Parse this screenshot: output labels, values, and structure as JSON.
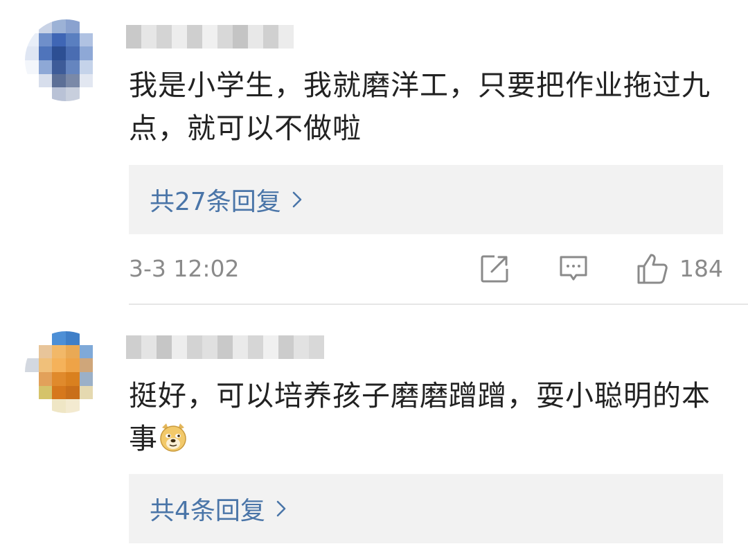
{
  "comments": [
    {
      "text": "我是小学生，我就磨洋工，只要把作业拖过九点，就可以不做啦",
      "replies_label": "共27条回复",
      "time": "3-3 12:02",
      "like_count": "184",
      "avatar_colors": [
        "#ffffff",
        "#c9d3e6",
        "#9cb2d6",
        "#8aa2cf",
        "#ffffff",
        "#ffffff",
        "#e8eef8",
        "#6f8fca",
        "#3f66b5",
        "#5a7fc0",
        "#b0c2e2",
        "#ffffff",
        "#dfe6f3",
        "#4f74bb",
        "#2d4f93",
        "#4a6db2",
        "#8ea8d6",
        "#ffffff",
        "#f3f6fb",
        "#8ea8d6",
        "#3d5b98",
        "#6585bf",
        "#c5d3ea",
        "#ffffff",
        "#ffffff",
        "#d7deec",
        "#5c6f96",
        "#7a89a8",
        "#e2e7f1",
        "#ffffff",
        "#ffffff",
        "#ffffff",
        "#b9c2d6",
        "#c8cfdd",
        "#ffffff",
        "#ffffff"
      ],
      "username_colors": [
        "#c9c9c9",
        "#e6e6e6",
        "#d4d4d4",
        "#ededed",
        "#cfcfcf",
        "#f0f0f0",
        "#d8d8d8",
        "#c4c4c4",
        "#e8e8e8",
        "#d0d0d0",
        "#ececec"
      ]
    },
    {
      "text_before": "挺好，可以培养孩子磨磨蹭蹭，耍小聪明的本事",
      "emoji": "doge-emoji",
      "replies_label": "共4条回复",
      "avatar_colors": [
        "#ffffff",
        "#ffffff",
        "#4d8fd6",
        "#3f7fc8",
        "#ffffff",
        "#ffffff",
        "#ffffff",
        "#e8c59a",
        "#f2b868",
        "#e9a955",
        "#7fa9d8",
        "#ffffff",
        "#d3d8e0",
        "#f0c07a",
        "#f5b25a",
        "#eea347",
        "#cfa67a",
        "#ffffff",
        "#ffffff",
        "#e2a15a",
        "#e08a2c",
        "#d9801f",
        "#9bb0c8",
        "#ffffff",
        "#ffffff",
        "#d5c36a",
        "#d6781c",
        "#c96f1a",
        "#e5d9b0",
        "#ffffff",
        "#ffffff",
        "#ffffff",
        "#efe6c5",
        "#f3ead0",
        "#ffffff",
        "#ffffff"
      ],
      "username_colors": [
        "#cfcfcf",
        "#e4e4e4",
        "#c6c6c6",
        "#ededed",
        "#d3d3d3",
        "#e0e0e0",
        "#c9c9c9",
        "#eaeaea",
        "#d6d6d6",
        "#f0f0f0",
        "#cccccc",
        "#e2e2e2",
        "#d8d8d8"
      ]
    }
  ],
  "colors": {
    "link_blue": "#4a75a8",
    "meta_gray": "#8a8a8a",
    "reply_bg": "#f2f2f2"
  },
  "icons": {
    "share": "share-icon",
    "comment": "comment-icon",
    "like": "thumbs-up-icon",
    "chevron": "chevron-right-icon"
  }
}
